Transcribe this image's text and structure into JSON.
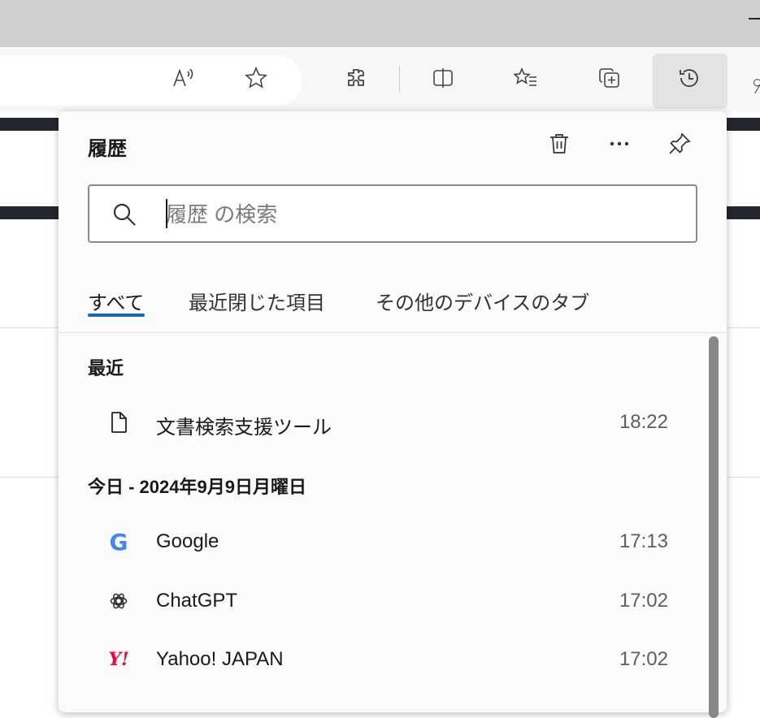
{
  "toolbar": {
    "icons": [
      "read-aloud-icon",
      "favorite-star-icon",
      "extensions-icon",
      "split-screen-icon",
      "favorites-icon",
      "collections-icon",
      "history-icon"
    ]
  },
  "history": {
    "title": "履歴",
    "search_placeholder": "履歴 の検索",
    "tabs": [
      {
        "label": "すべて",
        "active": true
      },
      {
        "label": "最近閉じた項目",
        "active": false
      },
      {
        "label": "その他のデバイスのタブ",
        "active": false
      }
    ],
    "sections": [
      {
        "heading": "最近",
        "items": [
          {
            "icon": "document-icon",
            "title": "文書検索支援ツール",
            "time": "18:22"
          }
        ]
      },
      {
        "heading": "今日 - 2024年9月9日月曜日",
        "items": [
          {
            "icon": "google-icon",
            "title": "Google",
            "time": "17:13"
          },
          {
            "icon": "chatgpt-icon",
            "title": "ChatGPT",
            "time": "17:02"
          },
          {
            "icon": "yahoo-icon",
            "title": "Yahoo! JAPAN",
            "time": "17:02"
          }
        ]
      }
    ],
    "logo_text": {
      "google": "G",
      "yahoo": "Y!"
    }
  },
  "colors": {
    "accent": "#0f6cbd",
    "yahoo": "#ff0033",
    "google": "#4285f4"
  }
}
